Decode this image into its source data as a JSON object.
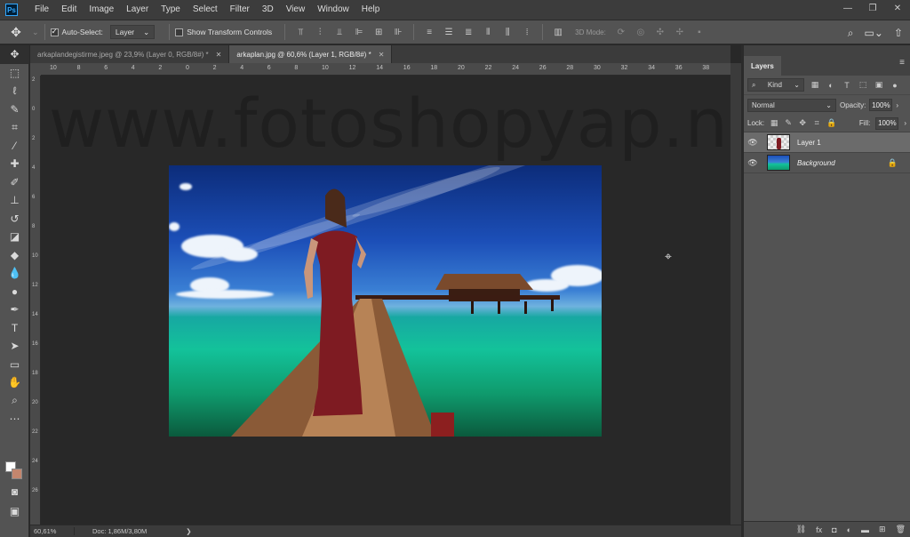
{
  "app": {
    "logo_text": "Ps",
    "menu": [
      "File",
      "Edit",
      "Image",
      "Layer",
      "Type",
      "Select",
      "Filter",
      "3D",
      "View",
      "Window",
      "Help"
    ],
    "window_controls": [
      "—",
      "❐",
      "✕"
    ]
  },
  "options_bar": {
    "auto_select_label": "Auto-Select:",
    "auto_select_checked": true,
    "auto_select_target": "Layer",
    "show_transform_label": "Show Transform Controls",
    "show_transform_checked": false,
    "mode_3d_label": "3D Mode:"
  },
  "document_tabs": [
    {
      "title": "arkaplandegistirme.jpeg @ 23,9% (Layer 0, RGB/8#) *",
      "close": "✕",
      "active": false
    },
    {
      "title": "arkaplan.jpg @ 60,6% (Layer 1, RGB/8#) *",
      "close": "✕",
      "active": true
    }
  ],
  "ruler": {
    "top_ticks": [
      "10",
      "8",
      "6",
      "4",
      "2",
      "0",
      "2",
      "4",
      "6",
      "8",
      "10",
      "12",
      "14",
      "16",
      "18",
      "20",
      "22",
      "24",
      "26",
      "28",
      "30",
      "32",
      "34",
      "36",
      "38"
    ],
    "left_ticks": [
      "2",
      "0",
      "2",
      "4",
      "6",
      "8",
      "10",
      "12",
      "14",
      "16",
      "18",
      "20",
      "22",
      "24",
      "26"
    ]
  },
  "canvas": {
    "watermark": "www.fotoshopyap.net"
  },
  "status_bar": {
    "zoom": "60,61%",
    "doc_info": "Doc: 1,86M/3,80M",
    "arrow": "❯"
  },
  "colors": {
    "foreground": "#ffffff",
    "background": "#c4866e",
    "accent": "#31a8ff"
  },
  "layers_panel": {
    "tab_label": "Layers",
    "kind_label": "Kind",
    "blend_mode": "Normal",
    "opacity_label": "Opacity:",
    "opacity_value": "100%",
    "lock_label": "Lock:",
    "fill_label": "Fill:",
    "fill_value": "100%",
    "layers": [
      {
        "name": "Layer 1",
        "visible": true,
        "selected": true,
        "locked": false
      },
      {
        "name": "Background",
        "visible": true,
        "selected": false,
        "locked": true
      }
    ]
  }
}
